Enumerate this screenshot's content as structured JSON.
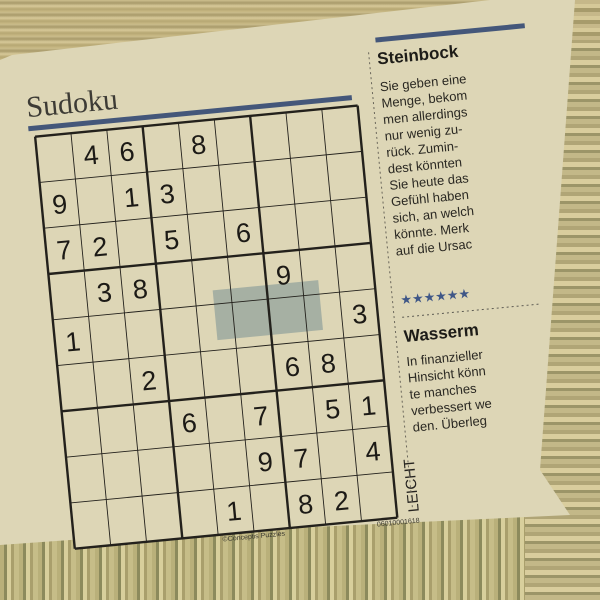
{
  "puzzle": {
    "title": "Sudoku",
    "difficulty": "LEICHT",
    "credit": "©Conceptis Puzzles",
    "code": "06010001618",
    "grid": [
      [
        0,
        4,
        6,
        0,
        8,
        0,
        0,
        0,
        0
      ],
      [
        9,
        0,
        1,
        3,
        0,
        0,
        0,
        0,
        0
      ],
      [
        7,
        2,
        0,
        5,
        0,
        6,
        0,
        0,
        0
      ],
      [
        0,
        3,
        8,
        0,
        0,
        0,
        9,
        0,
        0
      ],
      [
        1,
        0,
        0,
        0,
        0,
        0,
        0,
        0,
        3
      ],
      [
        0,
        0,
        2,
        0,
        0,
        0,
        6,
        8,
        0
      ],
      [
        0,
        0,
        0,
        6,
        0,
        7,
        0,
        5,
        1
      ],
      [
        0,
        0,
        0,
        0,
        0,
        9,
        7,
        0,
        4
      ],
      [
        0,
        0,
        0,
        0,
        1,
        0,
        8,
        2,
        0
      ]
    ]
  },
  "horoscope": {
    "sign1": "Steinbock",
    "text1": [
      "Sie geben eine",
      "Menge, bekom",
      "men allerdings",
      "nur wenig zu-",
      "rück. Zumin-",
      "dest könnten",
      "Sie heute das",
      "Gefühl haben",
      "sich, an welch",
      "könnte. Merk",
      "auf die Ursac"
    ],
    "stars": "★★★★★★",
    "sign2": "Wasserm",
    "text2": [
      "In finanzieller",
      "Hinsicht könn",
      "te manches",
      "verbessert we",
      "den. Überleg"
    ]
  }
}
